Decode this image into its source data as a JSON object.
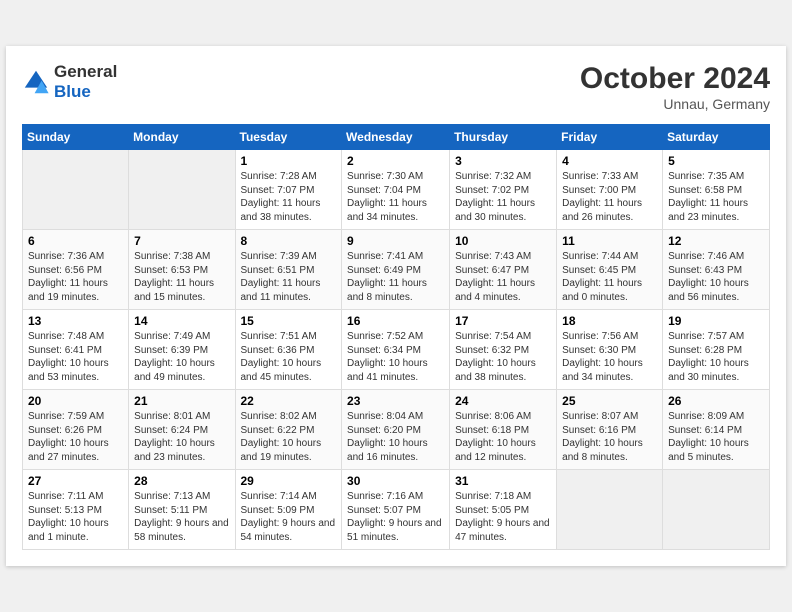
{
  "header": {
    "logo_line1": "General",
    "logo_line2": "Blue",
    "month": "October 2024",
    "location": "Unnau, Germany"
  },
  "weekdays": [
    "Sunday",
    "Monday",
    "Tuesday",
    "Wednesday",
    "Thursday",
    "Friday",
    "Saturday"
  ],
  "weeks": [
    [
      {
        "day": "",
        "empty": true
      },
      {
        "day": "",
        "empty": true
      },
      {
        "day": "1",
        "sunrise": "7:28 AM",
        "sunset": "7:07 PM",
        "daylight": "11 hours and 38 minutes."
      },
      {
        "day": "2",
        "sunrise": "7:30 AM",
        "sunset": "7:04 PM",
        "daylight": "11 hours and 34 minutes."
      },
      {
        "day": "3",
        "sunrise": "7:32 AM",
        "sunset": "7:02 PM",
        "daylight": "11 hours and 30 minutes."
      },
      {
        "day": "4",
        "sunrise": "7:33 AM",
        "sunset": "7:00 PM",
        "daylight": "11 hours and 26 minutes."
      },
      {
        "day": "5",
        "sunrise": "7:35 AM",
        "sunset": "6:58 PM",
        "daylight": "11 hours and 23 minutes."
      }
    ],
    [
      {
        "day": "6",
        "sunrise": "7:36 AM",
        "sunset": "6:56 PM",
        "daylight": "11 hours and 19 minutes."
      },
      {
        "day": "7",
        "sunrise": "7:38 AM",
        "sunset": "6:53 PM",
        "daylight": "11 hours and 15 minutes."
      },
      {
        "day": "8",
        "sunrise": "7:39 AM",
        "sunset": "6:51 PM",
        "daylight": "11 hours and 11 minutes."
      },
      {
        "day": "9",
        "sunrise": "7:41 AM",
        "sunset": "6:49 PM",
        "daylight": "11 hours and 8 minutes."
      },
      {
        "day": "10",
        "sunrise": "7:43 AM",
        "sunset": "6:47 PM",
        "daylight": "11 hours and 4 minutes."
      },
      {
        "day": "11",
        "sunrise": "7:44 AM",
        "sunset": "6:45 PM",
        "daylight": "11 hours and 0 minutes."
      },
      {
        "day": "12",
        "sunrise": "7:46 AM",
        "sunset": "6:43 PM",
        "daylight": "10 hours and 56 minutes."
      }
    ],
    [
      {
        "day": "13",
        "sunrise": "7:48 AM",
        "sunset": "6:41 PM",
        "daylight": "10 hours and 53 minutes."
      },
      {
        "day": "14",
        "sunrise": "7:49 AM",
        "sunset": "6:39 PM",
        "daylight": "10 hours and 49 minutes."
      },
      {
        "day": "15",
        "sunrise": "7:51 AM",
        "sunset": "6:36 PM",
        "daylight": "10 hours and 45 minutes."
      },
      {
        "day": "16",
        "sunrise": "7:52 AM",
        "sunset": "6:34 PM",
        "daylight": "10 hours and 41 minutes."
      },
      {
        "day": "17",
        "sunrise": "7:54 AM",
        "sunset": "6:32 PM",
        "daylight": "10 hours and 38 minutes."
      },
      {
        "day": "18",
        "sunrise": "7:56 AM",
        "sunset": "6:30 PM",
        "daylight": "10 hours and 34 minutes."
      },
      {
        "day": "19",
        "sunrise": "7:57 AM",
        "sunset": "6:28 PM",
        "daylight": "10 hours and 30 minutes."
      }
    ],
    [
      {
        "day": "20",
        "sunrise": "7:59 AM",
        "sunset": "6:26 PM",
        "daylight": "10 hours and 27 minutes."
      },
      {
        "day": "21",
        "sunrise": "8:01 AM",
        "sunset": "6:24 PM",
        "daylight": "10 hours and 23 minutes."
      },
      {
        "day": "22",
        "sunrise": "8:02 AM",
        "sunset": "6:22 PM",
        "daylight": "10 hours and 19 minutes."
      },
      {
        "day": "23",
        "sunrise": "8:04 AM",
        "sunset": "6:20 PM",
        "daylight": "10 hours and 16 minutes."
      },
      {
        "day": "24",
        "sunrise": "8:06 AM",
        "sunset": "6:18 PM",
        "daylight": "10 hours and 12 minutes."
      },
      {
        "day": "25",
        "sunrise": "8:07 AM",
        "sunset": "6:16 PM",
        "daylight": "10 hours and 8 minutes."
      },
      {
        "day": "26",
        "sunrise": "8:09 AM",
        "sunset": "6:14 PM",
        "daylight": "10 hours and 5 minutes."
      }
    ],
    [
      {
        "day": "27",
        "sunrise": "7:11 AM",
        "sunset": "5:13 PM",
        "daylight": "10 hours and 1 minute."
      },
      {
        "day": "28",
        "sunrise": "7:13 AM",
        "sunset": "5:11 PM",
        "daylight": "9 hours and 58 minutes."
      },
      {
        "day": "29",
        "sunrise": "7:14 AM",
        "sunset": "5:09 PM",
        "daylight": "9 hours and 54 minutes."
      },
      {
        "day": "30",
        "sunrise": "7:16 AM",
        "sunset": "5:07 PM",
        "daylight": "9 hours and 51 minutes."
      },
      {
        "day": "31",
        "sunrise": "7:18 AM",
        "sunset": "5:05 PM",
        "daylight": "9 hours and 47 minutes."
      },
      {
        "day": "",
        "empty": true
      },
      {
        "day": "",
        "empty": true
      }
    ]
  ]
}
